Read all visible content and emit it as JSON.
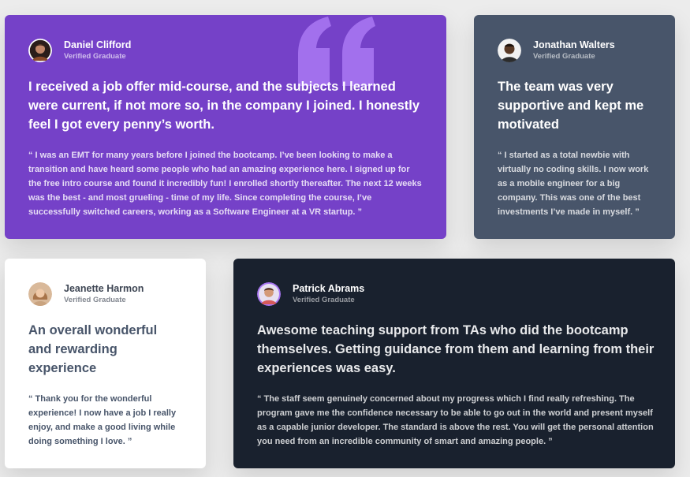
{
  "colors": {
    "purple": "#7541c8",
    "slate": "#48556a",
    "white": "#ffffff",
    "navy": "#19212e",
    "quote_mark": "#a775f1"
  },
  "testimonials": [
    {
      "name": "Daniel Clifford",
      "role": "Verified Graduate",
      "avatar_icon": "avatar-daniel-icon",
      "headline": "I received a job offer mid-course, and the subjects I learned were current, if not more so, in the company I joined. I honestly feel I got every penny’s worth.",
      "quote": "“ I was an EMT for many years before I joined the bootcamp. I’ve been looking to make a transition and have heard some people who had an amazing experience here. I signed up for the free intro course and found it incredibly fun! I enrolled shortly thereafter. The next 12 weeks was the best - and most grueling - time of my life. Since completing the course, I’ve successfully switched careers, working as a Software Engineer at a VR startup. ”"
    },
    {
      "name": "Jonathan Walters",
      "role": "Verified Graduate",
      "avatar_icon": "avatar-jonathan-icon",
      "headline": "The team was very supportive and kept me motivated",
      "quote": "“ I started as a total newbie with virtually no coding skills. I now work as a mobile engineer for a big company. This was one of the best investments I’ve made in myself. ”"
    },
    {
      "name": "Jeanette Harmon",
      "role": "Verified Graduate",
      "avatar_icon": "avatar-jeanette-icon",
      "headline": "An overall wonderful and rewarding experience",
      "quote": "“ Thank you for the wonderful experience! I now have a job I really enjoy, and make a good living while doing something I love. ”"
    },
    {
      "name": "Patrick Abrams",
      "role": "Verified Graduate",
      "avatar_icon": "avatar-patrick-icon",
      "headline": "Awesome teaching support from TAs who did the bootcamp themselves. Getting guidance from them and learning from their experiences was easy.",
      "quote": "“ The staff seem genuinely concerned about my progress which I find really refreshing. The program gave me the confidence necessary to be able to go out in the world and present myself as a capable junior developer. The standard is above the rest. You will get the personal attention you need from an incredible community of smart and amazing people. ”"
    }
  ]
}
